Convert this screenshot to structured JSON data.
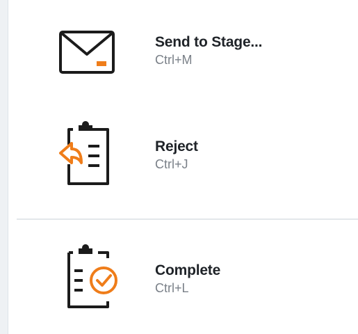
{
  "colors": {
    "accent": "#ef7d1a",
    "icon_stroke": "#1b1b1b",
    "label": "#1f2328",
    "shortcut": "#7a8088",
    "divider": "#e3e7ea"
  },
  "menu": {
    "items": [
      {
        "label": "Send to Stage...",
        "shortcut": "Ctrl+M",
        "icon": "envelope-icon"
      },
      {
        "label": "Reject",
        "shortcut": "Ctrl+J",
        "icon": "clipboard-reject-icon"
      },
      {
        "label": "Complete",
        "shortcut": "Ctrl+L",
        "icon": "clipboard-complete-icon"
      }
    ]
  }
}
